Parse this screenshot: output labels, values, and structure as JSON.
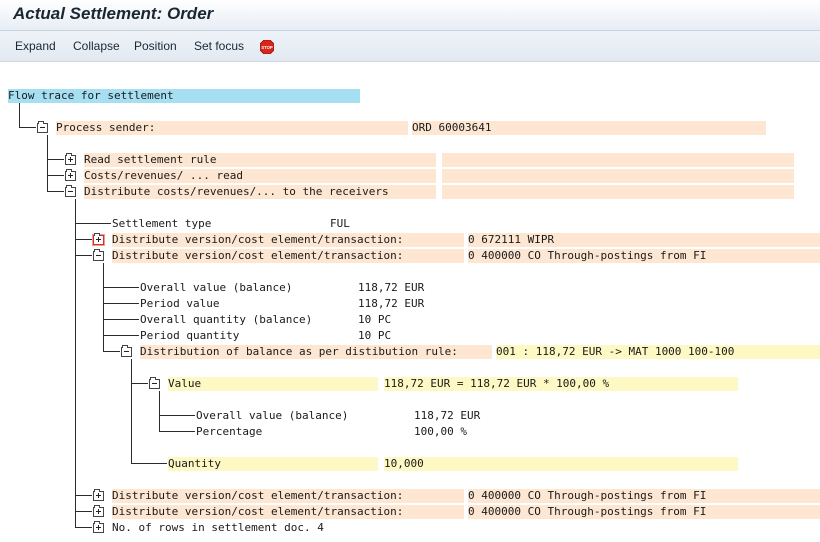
{
  "window": {
    "title": "Actual Settlement: Order"
  },
  "toolbar": {
    "expand": "Expand",
    "collapse": "Collapse",
    "position": "Position",
    "set_focus": "Set focus",
    "stop_icon": "STOP"
  },
  "tree": {
    "root": "Flow trace for settlement",
    "process_sender": {
      "label": "Process sender:",
      "value": "ORD 60003641"
    },
    "read_rule": "Read settlement rule",
    "costs_read": "Costs/revenues/ ... read",
    "distribute": "Distribute costs/revenues/... to the receivers",
    "settlement_type": {
      "label": "Settlement type",
      "value": "FUL"
    },
    "dist1": {
      "label": "Distribute version/cost element/transaction:",
      "value": "0 672111 WIPR"
    },
    "dist2": {
      "label": "Distribute version/cost element/transaction:",
      "value": "0 400000 CO Through-postings from FI"
    },
    "overall_value": {
      "label": "Overall value (balance)",
      "value": "118,72 EUR"
    },
    "period_value": {
      "label": "Period value",
      "value": "118,72 EUR"
    },
    "overall_qty": {
      "label": "Overall quantity (balance)",
      "value": "10 PC"
    },
    "period_qty": {
      "label": "Period quantity",
      "value": "10 PC"
    },
    "dist_balance": {
      "label": "Distribution of balance as per distibution rule:",
      "value": "001 : 118,72 EUR -> MAT 1000 100-100"
    },
    "value_node": {
      "label": "Value",
      "value": "118,72 EUR = 118,72 EUR * 100,00 %"
    },
    "overall_value2": {
      "label": "Overall value (balance)",
      "value": "118,72 EUR"
    },
    "percentage": {
      "label": "Percentage",
      "value": "100,00 %"
    },
    "quantity": {
      "label": "Quantity",
      "value": "10,000"
    },
    "dist3": {
      "label": "Distribute version/cost element/transaction:",
      "value": "0 400000 CO Through-postings from FI"
    },
    "dist4": {
      "label": "Distribute version/cost element/transaction:",
      "value": "0 400000 CO Through-postings from FI"
    },
    "rows_doc": "No. of rows in settlement doc. 4"
  },
  "colors": {
    "root_bg": "#a6dff2",
    "node_bg": "#fde6d2",
    "value_bg": "#fdf8c4",
    "stop": "#d8261c"
  }
}
